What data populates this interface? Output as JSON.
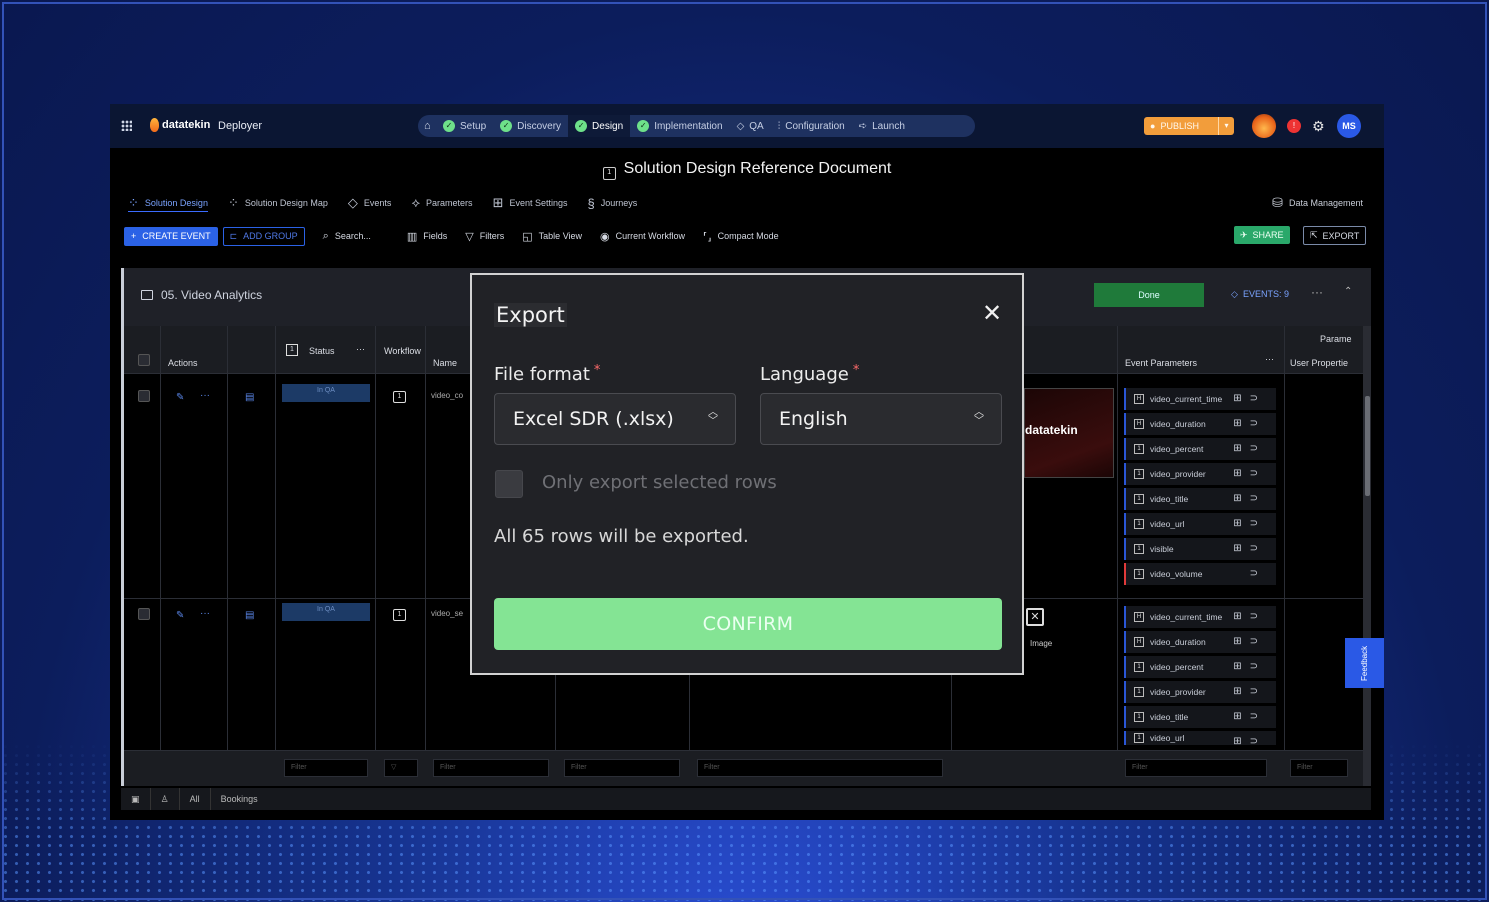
{
  "app": {
    "brand": "datatekin",
    "product": "Deployer",
    "steps": [
      {
        "label": "Setup",
        "done": true
      },
      {
        "label": "Discovery",
        "done": true
      },
      {
        "label": "Design",
        "done": true,
        "active": true
      },
      {
        "label": "Implementation",
        "done": true
      },
      {
        "label": "QA",
        "icon": "qa-icon"
      },
      {
        "label": "Configuration",
        "icon": "sliders-icon"
      },
      {
        "label": "Launch",
        "icon": "rocket-icon"
      }
    ],
    "publish_label": "PUBLISH",
    "user_initials": "MS",
    "accent": "#2b62e6"
  },
  "document": {
    "title": "Solution Design Reference Document"
  },
  "tabs": [
    "Solution Design",
    "Solution Design Map",
    "Events",
    "Parameters",
    "Event Settings",
    "Journeys"
  ],
  "data_management": "Data Management",
  "toolbar": {
    "create": "CREATE EVENT",
    "add_group": "ADD GROUP",
    "search": "Search...",
    "fields": "Fields",
    "filters": "Filters",
    "table_view": "Table View",
    "current_workflow": "Current Workflow",
    "compact_mode": "Compact Mode",
    "share": "SHARE",
    "export": "EXPORT"
  },
  "group": {
    "name": "05. Video Analytics",
    "done_label": "Done",
    "events_count": "EVENTS: 9"
  },
  "table": {
    "headers": {
      "actions": "Actions",
      "status": "Status",
      "workflow": "Workflow",
      "name": "Name",
      "parameters_group": "Parame",
      "event_parameters": "Event Parameters",
      "user_properties": "User Propertie"
    },
    "rows": [
      {
        "status": "In QA",
        "name": "video_co"
      },
      {
        "status": "In QA",
        "name": "video_se"
      }
    ],
    "params_row1": [
      "video_current_time",
      "video_duration",
      "video_percent",
      "video_provider",
      "video_title",
      "video_url",
      "visible",
      "video_volume"
    ],
    "params_row2": [
      "video_current_time",
      "video_duration",
      "video_percent",
      "video_provider",
      "video_title",
      "video_url"
    ],
    "preview_brand": "datatekin",
    "image_label": "Image",
    "filter_placeholder": "Filter"
  },
  "bottom_bar": {
    "all": "All",
    "bookings": "Bookings"
  },
  "feedback": "Feedback",
  "export_modal": {
    "title": "Export",
    "file_format_label": "File format",
    "file_format_value": "Excel SDR (.xlsx)",
    "language_label": "Language",
    "language_value": "English",
    "required_mark": "*",
    "only_selected_label": "Only export selected rows",
    "only_selected_checked": false,
    "info": "All 65 rows will be exported.",
    "confirm": "CONFIRM"
  }
}
